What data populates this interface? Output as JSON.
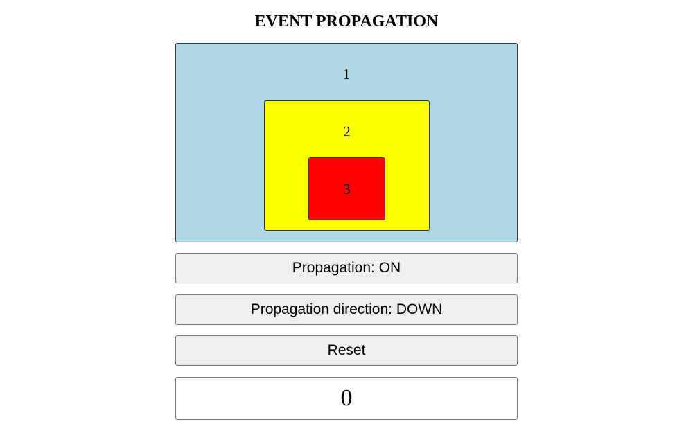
{
  "header": {
    "title": "EVENT PROPAGATION"
  },
  "boxes": [
    {
      "label": "1",
      "color": "#add8e6"
    },
    {
      "label": "2",
      "color": "#ffff00"
    },
    {
      "label": "3",
      "color": "#ff0000"
    }
  ],
  "controls": {
    "propagation_label": "Propagation: ON",
    "direction_label": "Propagation direction: DOWN",
    "reset_label": "Reset"
  },
  "counter": {
    "value": "0"
  }
}
